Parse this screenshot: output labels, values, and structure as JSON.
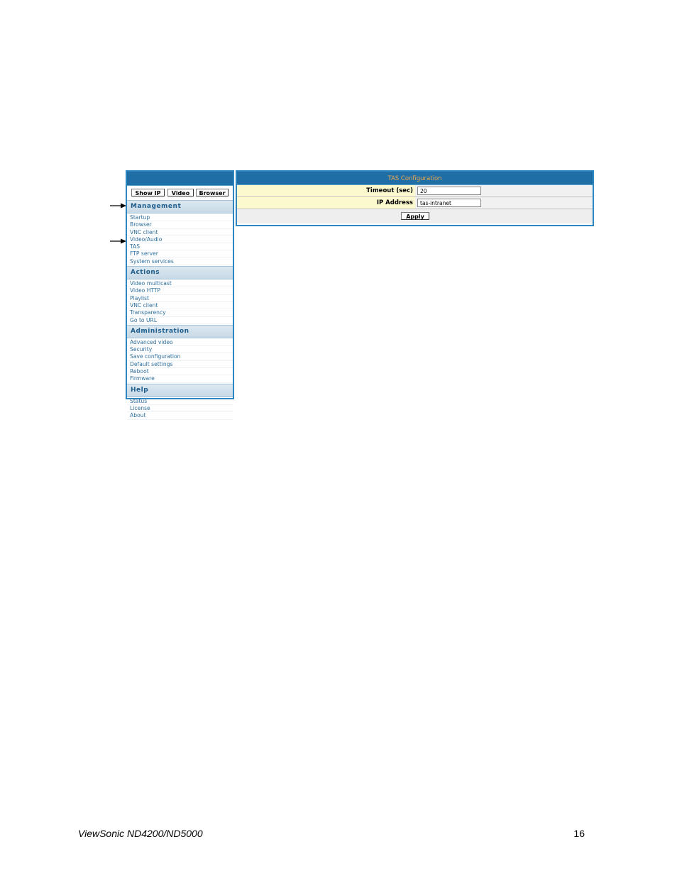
{
  "sidebar": {
    "buttons": [
      "Show IP",
      "Video",
      "Browser"
    ],
    "sections": [
      {
        "title": "Management",
        "items": [
          "Startup",
          "Browser",
          "VNC client",
          "Video/Audio",
          "TAS",
          "FTP server",
          "System services"
        ]
      },
      {
        "title": "Actions",
        "items": [
          "Video multicast",
          "Video HTTP",
          "Playlist",
          "VNC client",
          "Transparency",
          "Go to URL"
        ]
      },
      {
        "title": "Administration",
        "items": [
          "Advanced video",
          "Security",
          "Save configuration",
          "Default settings",
          "Reboot",
          "Firmware"
        ]
      },
      {
        "title": "Help",
        "items": [
          "Status",
          "License",
          "About"
        ]
      }
    ]
  },
  "panel": {
    "title": "TAS Configuration",
    "fields": [
      {
        "label": "Timeout (sec)",
        "value": "20"
      },
      {
        "label": "IP Address",
        "value": "tas-intranet"
      }
    ],
    "apply_label": "Apply"
  },
  "footer": {
    "product": "ViewSonic ND4200/ND5000",
    "page": "16"
  },
  "colors": {
    "header_blue": "#1f6fa6",
    "title_orange": "#f0a64a",
    "label_yellow": "#fdf9cf",
    "link_blue": "#2d6f9d"
  }
}
